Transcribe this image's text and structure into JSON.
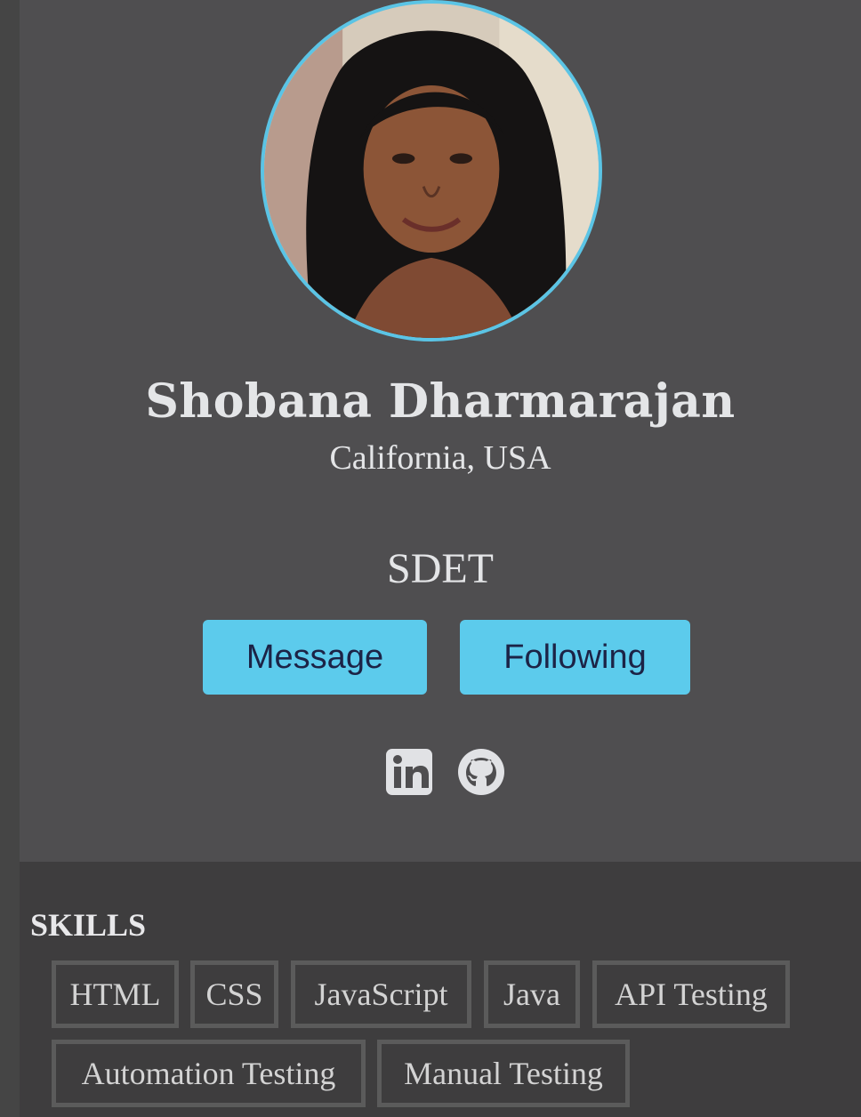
{
  "profile": {
    "name": "Shobana Dharmarajan",
    "location": "California, USA",
    "role": "SDET",
    "avatar_icon": "profile-photo"
  },
  "actions": {
    "message_label": "Message",
    "following_label": "Following"
  },
  "social": {
    "linkedin_icon": "linkedin-icon",
    "github_icon": "github-icon"
  },
  "skills": {
    "title": "SKILLS",
    "items": [
      "HTML",
      "CSS",
      "JavaScript",
      "Java",
      "API Testing",
      "Automation Testing",
      "Manual Testing"
    ]
  },
  "colors": {
    "accent": "#5ccbec",
    "avatar_ring": "#5bc4e5",
    "card_bg": "#4f4e50",
    "skills_bg": "#3e3d3e",
    "text": "#e4e5e7",
    "button_text": "#1c2346"
  }
}
